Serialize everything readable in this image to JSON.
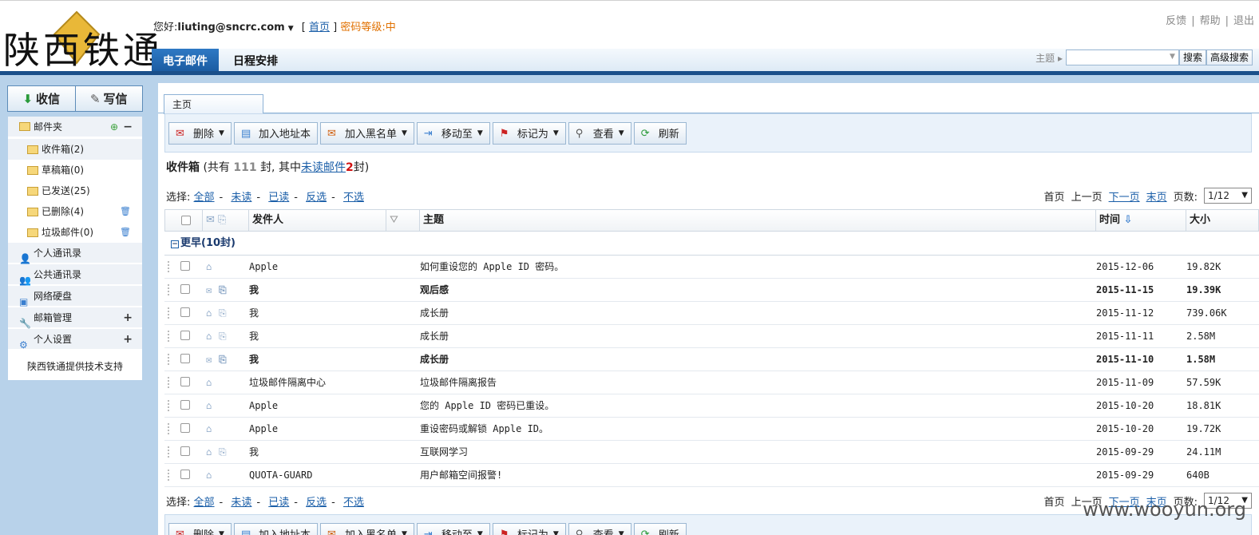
{
  "logo": {
    "text": "陕西铁通"
  },
  "header": {
    "greeting": "您好:",
    "email": "liuting@sncrc.com",
    "home_link": "首页",
    "password_level": "密码等级:中",
    "top_links": [
      "反馈",
      "帮助",
      "退出"
    ],
    "tabs": [
      "电子邮件",
      "日程安排"
    ],
    "search": {
      "label": "主题",
      "button": "搜索",
      "advanced": "高级搜索"
    }
  },
  "sidebar": {
    "receive": "收信",
    "compose": "写信",
    "mailbox_label": "邮件夹",
    "folders": [
      {
        "label": "收件箱",
        "count": "(2)"
      },
      {
        "label": "草稿箱",
        "count": "(0)"
      },
      {
        "label": "已发送",
        "count": "(25)"
      },
      {
        "label": "已删除",
        "count": "(4)"
      },
      {
        "label": "垃圾邮件",
        "count": "(0)"
      }
    ],
    "sections": [
      "个人通讯录",
      "公共通讯录",
      "网络硬盘",
      "邮箱管理",
      "个人设置"
    ],
    "support": "陕西铁通提供技术支持"
  },
  "main": {
    "tab": "主页",
    "toolbar": [
      "删除",
      "加入地址本",
      "加入黑名单",
      "移动至",
      "标记为",
      "查看",
      "刷新"
    ],
    "inbox": {
      "title": "收件箱",
      "p1": "(共有",
      "total": "111",
      "p2": "封, 其中",
      "unread_link": "未读邮件",
      "unread": "2",
      "p3": "封)"
    },
    "select": {
      "label": "选择:",
      "options": [
        "全部",
        "未读",
        "已读",
        "反选",
        "不选"
      ]
    },
    "pager": {
      "first": "首页",
      "prev": "上一页",
      "next": "下一页",
      "last": "末页",
      "pages_label": "页数:",
      "current": "1/12"
    },
    "columns": {
      "sender": "发件人",
      "subject": "主题",
      "time": "时间",
      "size": "大小"
    },
    "group": {
      "label": "更早",
      "count": "(10封)"
    },
    "emails": [
      {
        "sender": "Apple",
        "subject": "如何重设您的 Apple ID 密码。",
        "time": "2015-12-06",
        "size": "19.82K",
        "unread": false,
        "attach": false
      },
      {
        "sender": "我",
        "subject": "观后感",
        "time": "2015-11-15",
        "size": "19.39K",
        "unread": true,
        "attach": true
      },
      {
        "sender": "我",
        "subject": "成长册",
        "time": "2015-11-12",
        "size": "739.06K",
        "unread": false,
        "attach": true
      },
      {
        "sender": "我",
        "subject": "成长册",
        "time": "2015-11-11",
        "size": "2.58M",
        "unread": false,
        "attach": true
      },
      {
        "sender": "我",
        "subject": "成长册",
        "time": "2015-11-10",
        "size": "1.58M",
        "unread": true,
        "attach": true
      },
      {
        "sender": "垃圾邮件隔离中心",
        "subject": "垃圾邮件隔离报告",
        "time": "2015-11-09",
        "size": "57.59K",
        "unread": false,
        "attach": false
      },
      {
        "sender": "Apple",
        "subject": "您的 Apple ID 密码已重设。",
        "time": "2015-10-20",
        "size": "18.81K",
        "unread": false,
        "attach": false
      },
      {
        "sender": "Apple",
        "subject": "重设密码或解锁 Apple ID。",
        "time": "2015-10-20",
        "size": "19.72K",
        "unread": false,
        "attach": false
      },
      {
        "sender": "我",
        "subject": "互联网学习",
        "time": "2015-09-29",
        "size": "24.11M",
        "unread": false,
        "attach": true
      },
      {
        "sender": "QUOTA-GUARD",
        "subject": "用户邮箱空间报警!",
        "time": "2015-09-29",
        "size": "640B",
        "unread": false,
        "attach": false
      }
    ]
  },
  "watermark": "www.wooyun.org"
}
